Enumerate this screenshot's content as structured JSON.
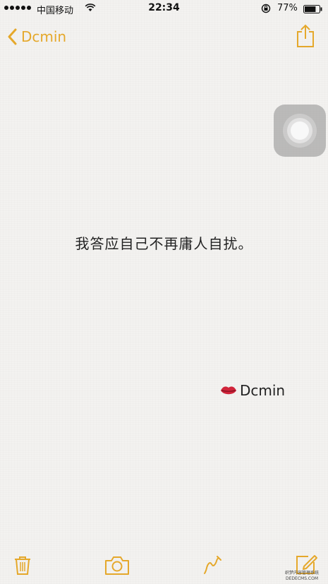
{
  "status_bar": {
    "carrier": "中国移动",
    "time": "22:34",
    "battery_percent": "77%",
    "battery_level": 0.77,
    "icons": [
      "signal-dots",
      "wifi-icon",
      "rotation-lock-icon",
      "battery-icon"
    ]
  },
  "nav": {
    "back_label": "Dcmin",
    "back_icon": "chevron-left-icon",
    "share_icon": "share-icon"
  },
  "note": {
    "body": "我答应自己不再庸人自扰。",
    "signature": "Dcmin",
    "signature_icon": "kiss-lips-icon"
  },
  "toolbar": {
    "icons": [
      "trash-icon",
      "camera-icon",
      "sketch-icon",
      "compose-icon"
    ]
  },
  "watermark": {
    "line1": "织梦内容管理系统",
    "line2": "DEDECMS.COM"
  },
  "colors": {
    "accent": "#e5a82b",
    "background": "#f3f2f0",
    "text": "#222222",
    "lips": "#d0243a"
  }
}
